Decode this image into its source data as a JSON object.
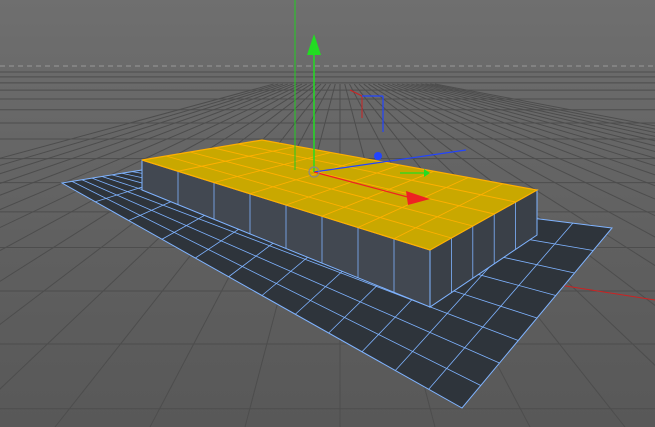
{
  "viewport": {
    "background": "#6a6a6a",
    "grid_color": "#4a4a4a",
    "grid_major_color": "#3c3c3c",
    "horizon_dash_color": "#9a9a9a"
  },
  "scene": {
    "object_type": "box",
    "selection": "top-face-polygons",
    "selected_face_color": "#d4b000",
    "selected_edge_color": "#ffb000",
    "wire_color": "#7fb3ff",
    "side_face_color": "#3a3f48",
    "floor_face_color": "#2c3138"
  },
  "gizmos": {
    "world_axis_x_color": "#cc2222",
    "world_axis_y_color": "#22cc22",
    "world_axis_z_color": "#2244ff",
    "move_handle_y_color": "#22dd22",
    "move_handle_x_color": "#ee2222",
    "move_handle_z_color": "#2244ff"
  }
}
